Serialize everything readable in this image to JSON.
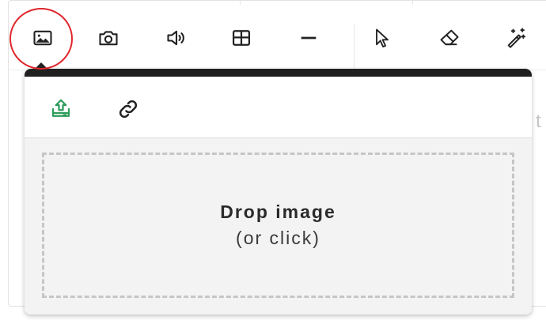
{
  "colors": {
    "icon_dark": "#222222",
    "upload_green": "#2e9c5c",
    "highlight_red": "#e0262b",
    "popover_header": "#202020",
    "dropzone_bg": "#f3f3f3"
  },
  "toolbar": {
    "buttons": [
      {
        "name": "insert-image",
        "icon": "image-icon"
      },
      {
        "name": "camera",
        "icon": "camera-icon"
      },
      {
        "name": "audio",
        "icon": "speaker-icon"
      },
      {
        "name": "table",
        "icon": "table-icon"
      },
      {
        "name": "divider-line",
        "icon": "minus-icon"
      },
      {
        "name": "select-pointer",
        "icon": "cursor-icon"
      },
      {
        "name": "eraser",
        "icon": "eraser-icon"
      },
      {
        "name": "magic-wand",
        "icon": "magic-wand-icon"
      }
    ]
  },
  "popover": {
    "tabs": [
      {
        "name": "upload",
        "icon": "upload-icon"
      },
      {
        "name": "link",
        "icon": "link-icon"
      }
    ],
    "dropzone": {
      "title": "Drop image",
      "subtitle": "(or click)"
    }
  },
  "edge_text": "t"
}
